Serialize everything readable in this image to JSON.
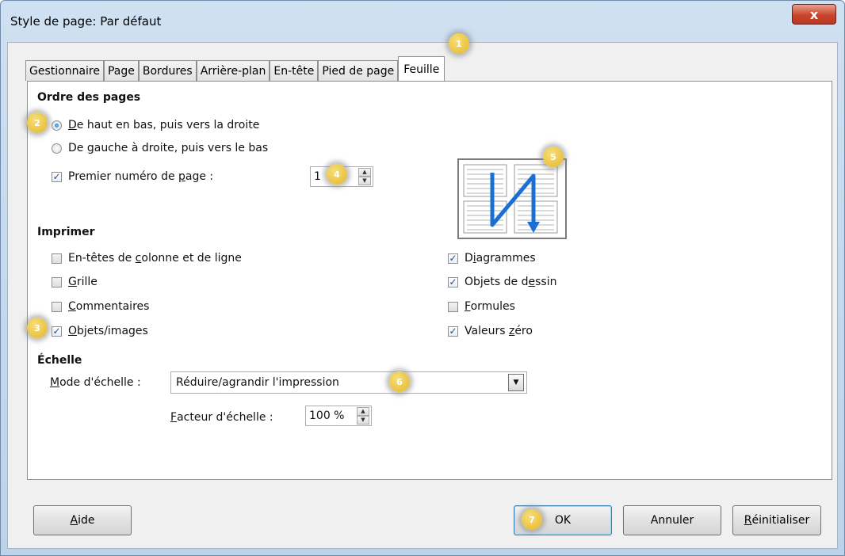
{
  "window": {
    "title": "Style de page: Par défaut",
    "close_label": "x"
  },
  "tabs": [
    {
      "label": "Gestionnaire"
    },
    {
      "label": "Page"
    },
    {
      "label": "Bordures"
    },
    {
      "label": "Arrière-plan"
    },
    {
      "label": "En-tête"
    },
    {
      "label": "Pied de page"
    },
    {
      "label": "Feuille",
      "active": true
    }
  ],
  "page_order": {
    "title": "Ordre des pages",
    "option1_ul": "D",
    "option1_rest": "e haut en bas, puis vers la droite",
    "option1_selected": true,
    "option2_pre": "De ",
    "option2_ul": "g",
    "option2_rest": "auche à droite, puis vers le bas",
    "option2_selected": false,
    "first_page_pre": "Premier numéro de ",
    "first_page_ul": "p",
    "first_page_rest": "age :",
    "first_page_checked": true,
    "first_page_value": "1"
  },
  "print": {
    "title": "Imprimer",
    "left_items": [
      {
        "pre": "En-têtes de ",
        "ul": "c",
        "rest": "olonne et de ligne",
        "checked": false
      },
      {
        "pre": "",
        "ul": "G",
        "rest": "rille",
        "checked": false
      },
      {
        "pre": "",
        "ul": "C",
        "rest": "ommentaires",
        "checked": false
      },
      {
        "pre": "",
        "ul": "O",
        "rest": "bjets/images",
        "checked": true
      }
    ],
    "right_items": [
      {
        "pre": "D",
        "ul": "i",
        "rest": "agrammes",
        "checked": true
      },
      {
        "pre": "Objets de d",
        "ul": "e",
        "rest": "ssin",
        "checked": true
      },
      {
        "pre": "",
        "ul": "F",
        "rest": "ormules",
        "checked": false
      },
      {
        "pre": "Valeurs ",
        "ul": "z",
        "rest": "éro",
        "checked": true
      }
    ]
  },
  "scale": {
    "title": "Échelle",
    "mode_ul": "M",
    "mode_rest": "ode d'échelle :",
    "mode_value": "Réduire/agrandir l'impression",
    "factor_ul": "F",
    "factor_rest": "acteur d'échelle :",
    "factor_value": "100 %"
  },
  "buttons": {
    "help_ul": "A",
    "help_rest": "ide",
    "ok": "OK",
    "cancel": "Annuler",
    "reset_ul": "R",
    "reset_rest": "éinitialiser"
  },
  "callouts": [
    "1",
    "2",
    "3",
    "4",
    "5",
    "6",
    "7"
  ],
  "colors": {
    "accent_arrow": "#1a6fd0",
    "badge": "#e9c13a"
  }
}
